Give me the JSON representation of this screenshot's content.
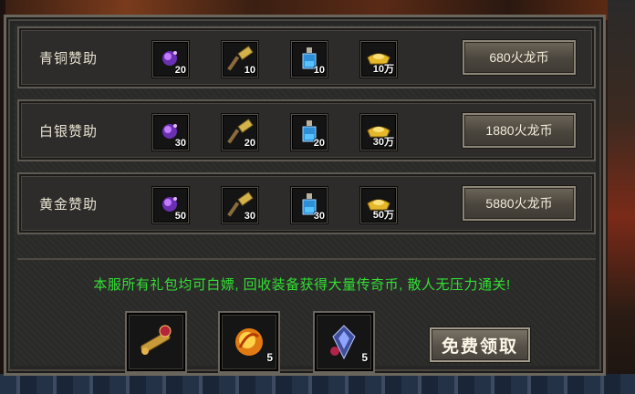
{
  "tiers": [
    {
      "label": "青铜赞助",
      "items": [
        {
          "icon": "purple-gem-icon",
          "qty": "20"
        },
        {
          "icon": "hammer-icon",
          "qty": "10"
        },
        {
          "icon": "potion-bottle-icon",
          "qty": "10"
        },
        {
          "icon": "gold-ingot-icon",
          "qty": "10万"
        }
      ],
      "button": "680火龙币"
    },
    {
      "label": "白银赞助",
      "items": [
        {
          "icon": "purple-gem-icon",
          "qty": "30"
        },
        {
          "icon": "hammer-icon",
          "qty": "20"
        },
        {
          "icon": "potion-bottle-icon",
          "qty": "20"
        },
        {
          "icon": "gold-ingot-icon",
          "qty": "30万"
        }
      ],
      "button": "1880火龙币"
    },
    {
      "label": "黄金赞助",
      "items": [
        {
          "icon": "purple-gem-icon",
          "qty": "50"
        },
        {
          "icon": "hammer-icon",
          "qty": "30"
        },
        {
          "icon": "potion-bottle-icon",
          "qty": "30"
        },
        {
          "icon": "gold-ingot-icon",
          "qty": "50万"
        }
      ],
      "button": "5880火龙币"
    }
  ],
  "notice": "本服所有礼包均可白嫖, 回收装备获得大量传奇币, 散人无压力通关!",
  "free_rewards": [
    {
      "icon": "telescope-icon",
      "qty": ""
    },
    {
      "icon": "fire-orb-icon",
      "qty": "5"
    },
    {
      "icon": "crystal-charm-icon",
      "qty": "5"
    }
  ],
  "claim_button": "免费领取",
  "colors": {
    "notice": "#33e033",
    "panel": "#2b2b2a",
    "border": "#6b665c"
  }
}
